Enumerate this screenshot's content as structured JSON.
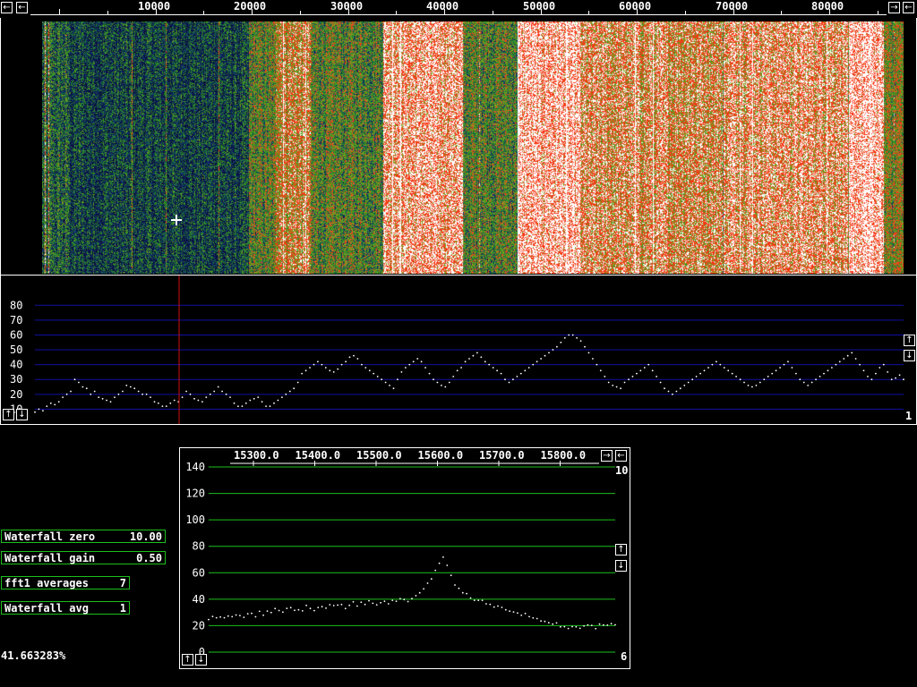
{
  "colors": {
    "background": "#000000",
    "frame": "#ffffff",
    "panel_border": "#1cbf1c",
    "grid_blue": "#1010a0",
    "grid_green": "#1cbf1c",
    "cursor_red": "#d01010",
    "waterfall_palette": [
      "#0a1040",
      "#10306a",
      "#1a6a3a",
      "#3a9a20",
      "#7aa020",
      "#e05020",
      "#ff3010",
      "#ffffff"
    ]
  },
  "top_scale": {
    "ticks": [
      "10000",
      "20000",
      "30000",
      "40000",
      "50000",
      "60000",
      "70000",
      "80000"
    ],
    "left_icon": "left-arrow",
    "right_icons": [
      "right-arrow",
      "left-arrow"
    ]
  },
  "waterfall": {
    "cursor_icon": "crosshair"
  },
  "spectrum": {
    "y_ticks": [
      "80",
      "70",
      "60",
      "50",
      "40",
      "30",
      "20",
      "10"
    ],
    "right_value": "1",
    "icons": [
      "up-arrow",
      "down-arrow"
    ]
  },
  "params": {
    "wf_zero_label": "Waterfall zero",
    "wf_zero_value": "10.00",
    "wf_gain_label": "Waterfall gain",
    "wf_gain_value": "0.50",
    "fft_avg_label": "fft1 averages",
    "fft_avg_value": "7",
    "wf_avg_label": "Waterfall avg",
    "wf_avg_value": "1"
  },
  "status": {
    "percent": "41.663283%"
  },
  "zoom": {
    "x_ticks": [
      "15300.0",
      "15400.0",
      "15500.0",
      "15600.0",
      "15700.0",
      "15800.0"
    ],
    "y_ticks": [
      "140",
      "120",
      "100",
      "80",
      "60",
      "40",
      "20",
      "0"
    ],
    "top_right_value": "10",
    "bottom_right_value": "6"
  },
  "chart_data": [
    {
      "type": "scatter",
      "title": "",
      "xlabel": "",
      "ylabel": "",
      "ylim": [
        0,
        88
      ],
      "grid": true,
      "series": [
        {
          "values": [
            8,
            10,
            9,
            12,
            14,
            13,
            15,
            18,
            20,
            22,
            30,
            28,
            25,
            24,
            20,
            22,
            18,
            17,
            16,
            15,
            18,
            20,
            22,
            26,
            25,
            24,
            22,
            20,
            20,
            18,
            15,
            14,
            12,
            12,
            14,
            16,
            15,
            18,
            22,
            20,
            17,
            16,
            15,
            18,
            20,
            22,
            25,
            22,
            20,
            18,
            14,
            12,
            12,
            14,
            16,
            17,
            18,
            15,
            12,
            12,
            14,
            16,
            18,
            20,
            22,
            24,
            28,
            34,
            36,
            38,
            40,
            42,
            40,
            38,
            36,
            35,
            37,
            40,
            42,
            45,
            46,
            44,
            40,
            38,
            36,
            34,
            32,
            30,
            28,
            26,
            24,
            30,
            35,
            38,
            40,
            42,
            44,
            42,
            38,
            34,
            30,
            28,
            26,
            25,
            28,
            32,
            36,
            38,
            42,
            44,
            46,
            48,
            45,
            42,
            40,
            38,
            36,
            34,
            30,
            28,
            30,
            32,
            34,
            36,
            38,
            40,
            42,
            44,
            46,
            48,
            50,
            52,
            55,
            58,
            60,
            60,
            58,
            56,
            52,
            48,
            44,
            40,
            36,
            32,
            28,
            26,
            25,
            24,
            28,
            30,
            32,
            34,
            36,
            38,
            40,
            36,
            32,
            28,
            24,
            22,
            20,
            22,
            24,
            26,
            28,
            30,
            32,
            34,
            36,
            38,
            40,
            42,
            40,
            38,
            36,
            34,
            32,
            30,
            28,
            26,
            25,
            26,
            28,
            30,
            32,
            34,
            36,
            38,
            40,
            42,
            38,
            34,
            30,
            28,
            26,
            28,
            30,
            32,
            34,
            36,
            38,
            40,
            42,
            44,
            46,
            48,
            44,
            40,
            36,
            32,
            30,
            34,
            38,
            40,
            35,
            30,
            31,
            33,
            30
          ]
        }
      ]
    },
    {
      "type": "scatter",
      "title": "",
      "xlabel": "",
      "ylabel": "",
      "x_ticks": [
        "15300.0",
        "15400.0",
        "15500.0",
        "15600.0",
        "15700.0",
        "15800.0"
      ],
      "ylim": [
        0,
        140
      ],
      "grid": true,
      "series": [
        {
          "values": [
            24,
            26,
            25,
            27,
            26,
            28,
            27,
            29,
            28,
            27,
            29,
            30,
            28,
            30,
            29,
            31,
            30,
            32,
            31,
            30,
            32,
            33,
            31,
            33,
            32,
            34,
            33,
            32,
            34,
            35,
            33,
            35,
            34,
            36,
            35,
            34,
            36,
            37,
            35,
            37,
            36,
            38,
            37,
            36,
            38,
            39,
            37,
            39,
            38,
            40,
            39,
            38,
            40,
            42,
            44,
            48,
            52,
            56,
            62,
            68,
            72,
            65,
            58,
            52,
            48,
            45,
            43,
            42,
            40,
            39,
            38,
            37,
            36,
            35,
            34,
            33,
            32,
            31,
            30,
            30,
            29,
            28,
            27,
            26,
            25,
            24,
            23,
            22,
            22,
            21,
            20,
            20,
            19,
            19,
            18,
            18,
            19,
            20,
            19,
            18,
            20,
            21,
            20,
            22,
            21
          ]
        }
      ]
    }
  ]
}
